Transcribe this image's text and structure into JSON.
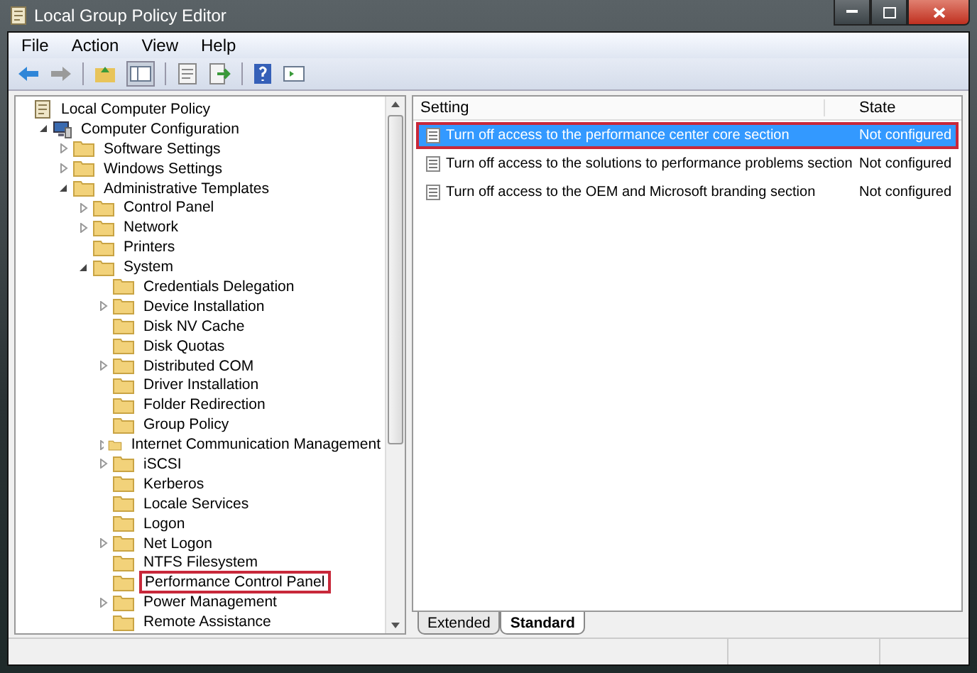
{
  "window": {
    "title": "Local Group Policy Editor"
  },
  "menu": [
    "File",
    "Action",
    "View",
    "Help"
  ],
  "tree": [
    {
      "label": "Local Computer Policy",
      "kind": "policy",
      "selected": false,
      "children": [
        {
          "label": "Computer Configuration",
          "kind": "computer",
          "selected": false,
          "expanded": true,
          "children": [
            {
              "label": "Software Settings",
              "kind": "folder",
              "selected": false,
              "expanded": false
            },
            {
              "label": "Windows Settings",
              "kind": "folder",
              "selected": false,
              "expanded": false
            },
            {
              "label": "Administrative Templates",
              "kind": "folder",
              "selected": false,
              "expanded": true,
              "children": [
                {
                  "label": "Control Panel",
                  "kind": "folder",
                  "selected": false,
                  "expanded": false
                },
                {
                  "label": "Network",
                  "kind": "folder",
                  "selected": false,
                  "expanded": false
                },
                {
                  "label": "Printers",
                  "kind": "folder",
                  "selected": false
                },
                {
                  "label": "System",
                  "kind": "folder",
                  "selected": false,
                  "expanded": true,
                  "children": [
                    {
                      "label": "Credentials Delegation",
                      "kind": "folder",
                      "selected": false
                    },
                    {
                      "label": "Device Installation",
                      "kind": "folder",
                      "selected": false,
                      "expanded": false
                    },
                    {
                      "label": "Disk NV Cache",
                      "kind": "folder",
                      "selected": false
                    },
                    {
                      "label": "Disk Quotas",
                      "kind": "folder",
                      "selected": false
                    },
                    {
                      "label": "Distributed COM",
                      "kind": "folder",
                      "selected": false,
                      "expanded": false
                    },
                    {
                      "label": "Driver Installation",
                      "kind": "folder",
                      "selected": false
                    },
                    {
                      "label": "Folder Redirection",
                      "kind": "folder",
                      "selected": false
                    },
                    {
                      "label": "Group Policy",
                      "kind": "folder",
                      "selected": false
                    },
                    {
                      "label": "Internet Communication Management",
                      "kind": "folder",
                      "selected": false,
                      "expanded": false
                    },
                    {
                      "label": "iSCSI",
                      "kind": "folder",
                      "selected": false,
                      "expanded": false
                    },
                    {
                      "label": "Kerberos",
                      "kind": "folder",
                      "selected": false
                    },
                    {
                      "label": "Locale Services",
                      "kind": "folder",
                      "selected": false
                    },
                    {
                      "label": "Logon",
                      "kind": "folder",
                      "selected": false
                    },
                    {
                      "label": "Net Logon",
                      "kind": "folder",
                      "selected": false,
                      "expanded": false
                    },
                    {
                      "label": "NTFS Filesystem",
                      "kind": "folder",
                      "selected": false
                    },
                    {
                      "label": "Performance Control Panel",
                      "kind": "folder",
                      "selected": true
                    },
                    {
                      "label": "Power Management",
                      "kind": "folder",
                      "selected": false,
                      "expanded": false
                    },
                    {
                      "label": "Remote Assistance",
                      "kind": "folder",
                      "selected": false
                    }
                  ]
                }
              ]
            }
          ]
        }
      ]
    }
  ],
  "table": {
    "columns": [
      "Setting",
      "State"
    ],
    "rows": [
      {
        "setting": "Turn off access to the performance center core section",
        "state": "Not configured",
        "selected": true
      },
      {
        "setting": "Turn off access to the solutions to performance problems section",
        "state": "Not configured",
        "selected": false
      },
      {
        "setting": "Turn off access to the OEM and Microsoft branding section",
        "state": "Not configured",
        "selected": false
      }
    ]
  },
  "view_tabs": [
    {
      "label": "Extended",
      "selected": false
    },
    {
      "label": "Standard",
      "selected": true
    }
  ]
}
